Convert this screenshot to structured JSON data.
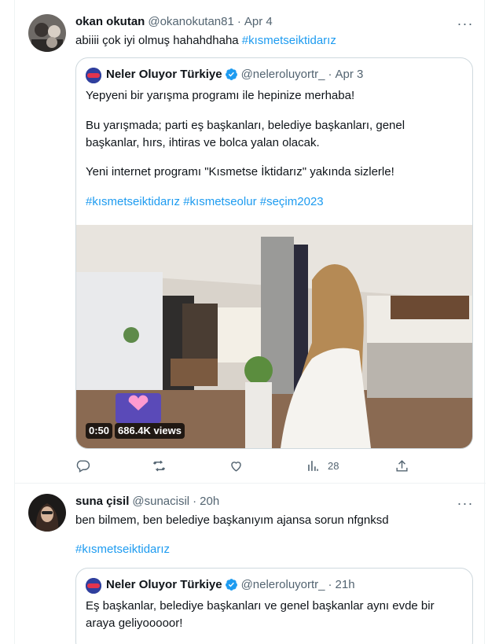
{
  "tweets": [
    {
      "author_name": "okan okutan",
      "author_handle": "@okanokutan81",
      "time": "Apr 4",
      "text_plain": "abiiii çok iyi olmuş hahahdhaha ",
      "text_hashtag": "#kısmetseiktidarız",
      "quote": {
        "author_name": "Neler Oluyor Türkiye",
        "author_handle": "@neleroluyortr_",
        "time": "Apr 3",
        "lines": [
          "Yepyeni bir yarışma programı ile hepinize merhaba!",
          "Bu yarışmada; parti eş başkanları, belediye başkanları, genel",
          "başkanlar, hırs, ihtiras ve bolca yalan olacak.",
          "Yeni internet programı \"Kısmetse İktidarız\" yakında sizlerle!",
          "#kısmetseiktidarız #kısmetseolur #seçim2023"
        ],
        "video": {
          "duration": "0:50",
          "views": "686.4K views"
        }
      },
      "actions": {
        "reply": "",
        "retweet": "",
        "like": "",
        "views": "28"
      }
    },
    {
      "author_name": "suna çisil",
      "author_handle": "@sunacisil",
      "time": "20h",
      "text_plain": "ben bilmem, ben belediye başkanıyım ajansa sorun nfgnksd",
      "text_hashtag": "#kısmetseiktidarız",
      "quote": {
        "author_name": "Neler Oluyor Türkiye",
        "author_handle": "@neleroluyortr_",
        "time": "21h",
        "lines": [
          "Eş başkanlar, belediye başkanları ve genel başkanlar aynı evde bir",
          "araya geliyooooor!"
        ]
      }
    }
  ],
  "colors": {
    "accent": "#1d9bf0",
    "secondary_text": "#536471",
    "border": "#cfd9de"
  },
  "icons": [
    "more-icon",
    "verified-icon",
    "reply-icon",
    "retweet-icon",
    "like-icon",
    "views-icon",
    "share-icon"
  ]
}
